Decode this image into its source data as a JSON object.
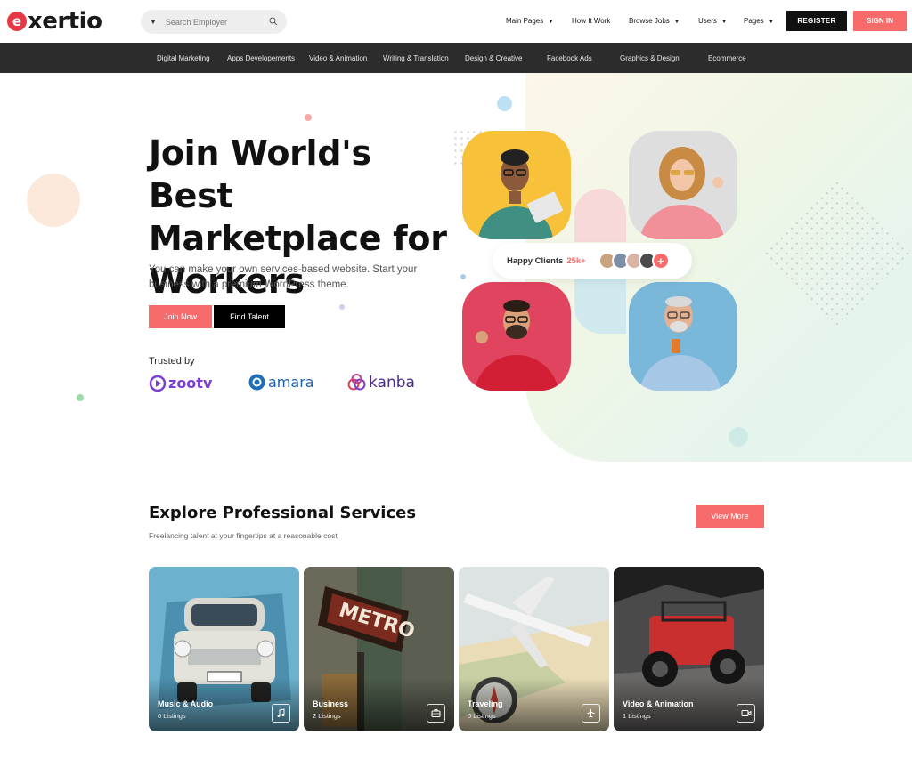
{
  "logo": {
    "letter": "e",
    "text": "xertio"
  },
  "search": {
    "placeholder": "Search Employer"
  },
  "nav": [
    {
      "label": "Main Pages",
      "dropdown": true
    },
    {
      "label": "How It Work",
      "dropdown": false
    },
    {
      "label": "Browse Jobs",
      "dropdown": true
    },
    {
      "label": "Users",
      "dropdown": true
    },
    {
      "label": "Pages",
      "dropdown": true
    }
  ],
  "header_buttons": {
    "register": "REGISTER",
    "signin": "SIGN IN"
  },
  "categories": [
    "Digital Marketing",
    "Apps Developements",
    "Video & Animation",
    "Writing & Translation",
    "Design & Creative",
    "Facebook Ads",
    "Graphics & Design",
    "Ecommerce"
  ],
  "hero": {
    "title": "Join World's Best Marketplace for Workers",
    "subtitle": "You can make your own services-based website. Start your business with a premium WordPress theme.",
    "join_label": "Join Now",
    "find_label": "Find Talent",
    "trusted_label": "Trusted by",
    "brands": [
      "zootv",
      "amara",
      "kanba"
    ],
    "happy_label": "Happy Clients",
    "happy_count": "25k+",
    "happy_plus": "+"
  },
  "services": {
    "title": "Explore Professional Services",
    "subtitle": "Freelancing talent at your fingertips at a reasonable cost",
    "view_more": "View More",
    "cards": [
      {
        "title": "Music & Audio",
        "listings": "0 Listings",
        "icon": "music-icon"
      },
      {
        "title": "Business",
        "listings": "2 Listings",
        "icon": "briefcase-icon"
      },
      {
        "title": "Traveling",
        "listings": "0 Listings",
        "icon": "plane-icon"
      },
      {
        "title": "Video & Animation",
        "listings": "1 Listings",
        "icon": "video-icon"
      }
    ]
  },
  "colors": {
    "accent": "#f76b6b",
    "dark": "#111111",
    "category_bar": "#2c2c2c"
  }
}
